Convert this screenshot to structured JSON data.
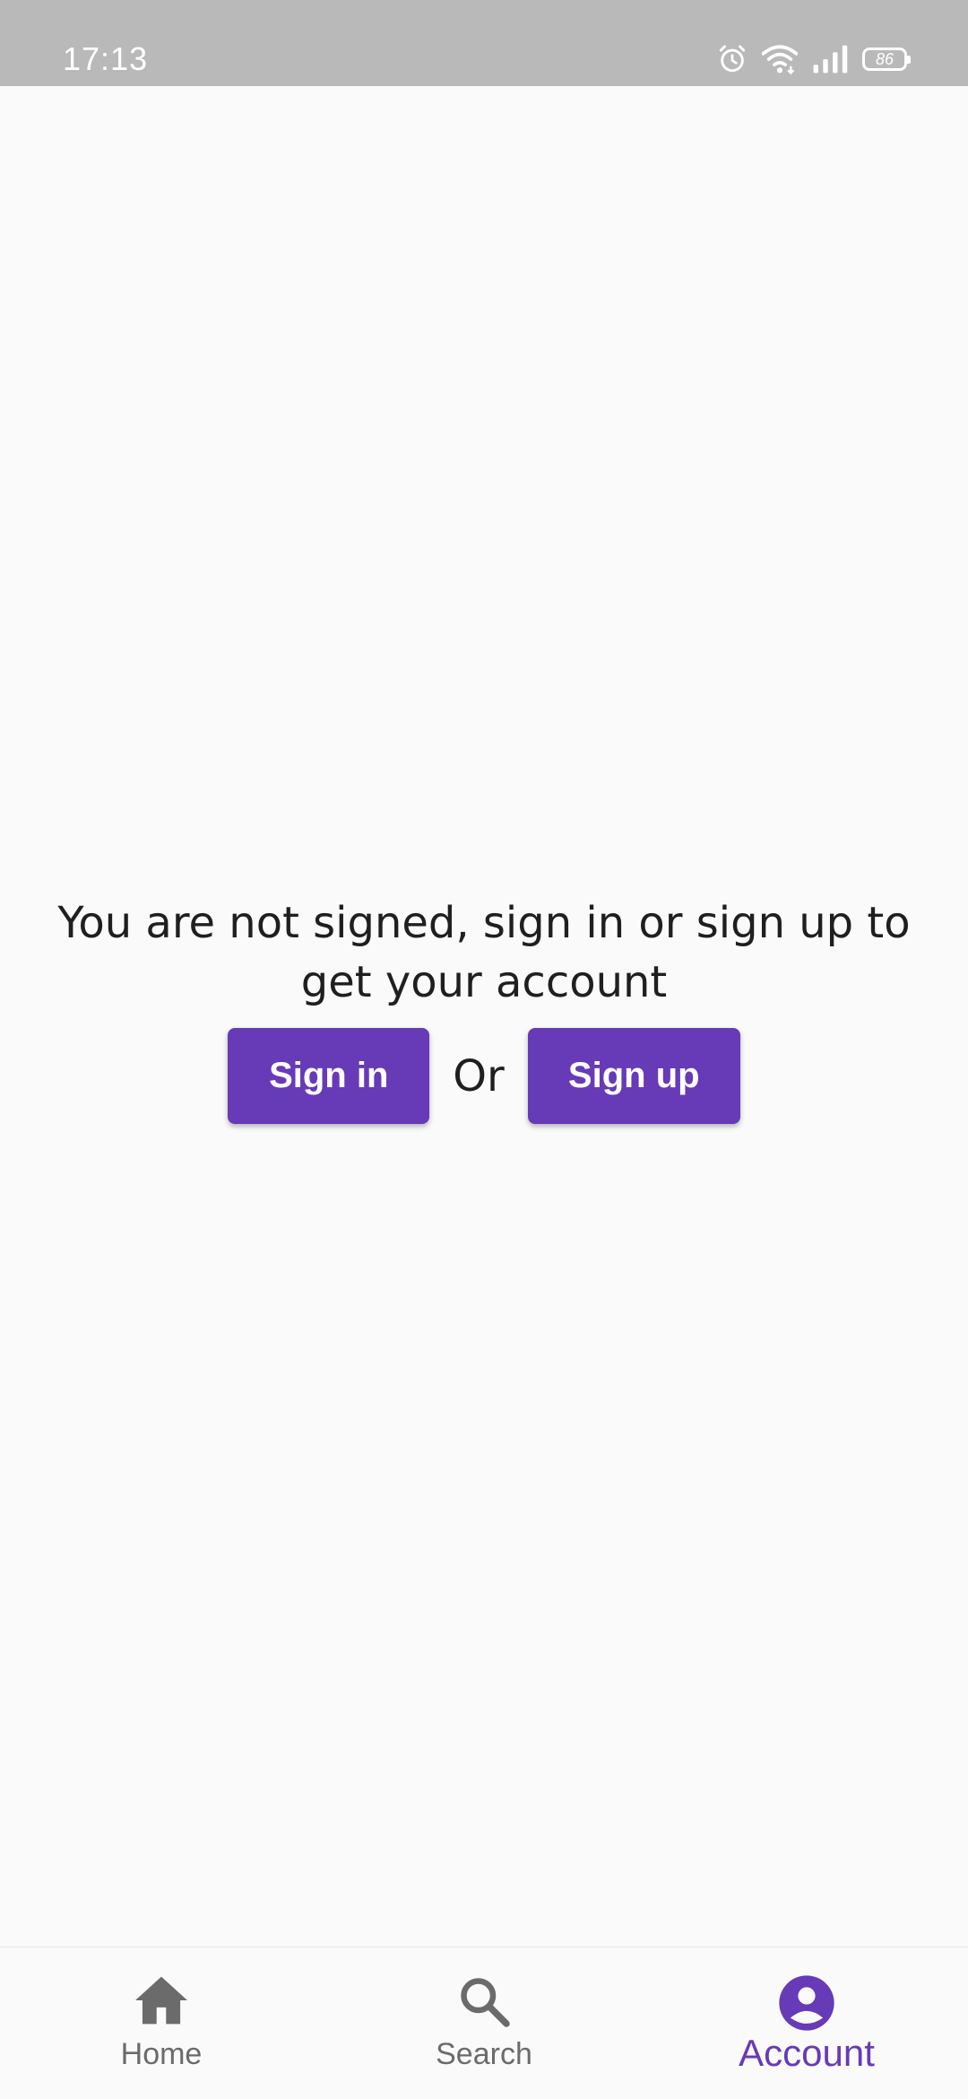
{
  "status_bar": {
    "time": "17:13",
    "battery_level": "86",
    "icons": [
      "alarm-icon",
      "wifi-icon",
      "signal-icon",
      "battery-icon"
    ]
  },
  "main": {
    "message": "You are not signed, sign in or sign up to get your account",
    "sign_in_label": "Sign in",
    "or_label": "Or",
    "sign_up_label": "Sign up"
  },
  "bottom_nav": {
    "items": [
      {
        "label": "Home",
        "icon": "home-icon",
        "active": false
      },
      {
        "label": "Search",
        "icon": "search-icon",
        "active": false
      },
      {
        "label": "Account",
        "icon": "account-circle-icon",
        "active": true
      }
    ]
  },
  "colors": {
    "accent": "#673ab7",
    "status_bar": "#b9b9b9",
    "background": "#fafafa",
    "inactive": "#6b6b6b",
    "text": "#1f1f1f"
  }
}
